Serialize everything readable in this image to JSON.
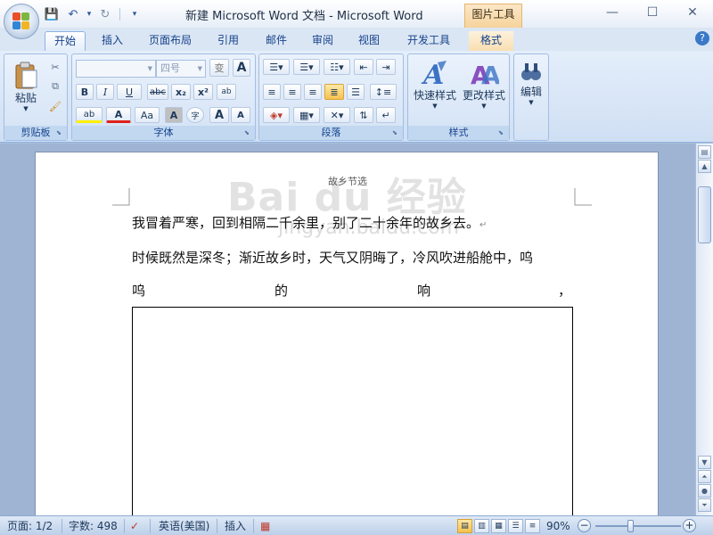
{
  "window": {
    "title": "新建 Microsoft Word 文档 - Microsoft Word",
    "contextual_tab_group": "图片工具",
    "controls": {
      "minimize": "—",
      "maximize": "☐",
      "close": "✕"
    }
  },
  "quick_access": {
    "save": "💾",
    "undo": "↶",
    "redo": "↻",
    "customize": "▾"
  },
  "ribbon_tabs": [
    "开始",
    "插入",
    "页面布局",
    "引用",
    "邮件",
    "审阅",
    "视图",
    "开发工具",
    "格式"
  ],
  "help": "?",
  "groups": {
    "clipboard": {
      "label": "剪贴板",
      "paste": "粘贴",
      "cut": "✂",
      "copy": "⧉",
      "format_painter": "🖌"
    },
    "font": {
      "label": "字体",
      "font_name": "",
      "font_size": "四号",
      "change_case": "变",
      "clear_format": "A",
      "bold": "B",
      "italic": "I",
      "underline": "U",
      "strike": "abc",
      "subscript": "x₂",
      "superscript": "x²",
      "phonetic": "ab",
      "highlight": "ab",
      "font_color": "A",
      "case": "Aa",
      "char_shading": "A",
      "enclose": "字",
      "grow": "A",
      "shrink": "A"
    },
    "paragraph": {
      "label": "段落"
    },
    "styles": {
      "label": "样式",
      "quick_styles": "快速样式",
      "change_styles": "更改样式"
    },
    "editing": {
      "label": "编辑"
    }
  },
  "document": {
    "header_text": "故乡节选",
    "watermark": "Bai du 经验",
    "watermark_url": "jingyan.baidu.com",
    "paragraphs": [
      "我冒着严寒，回到相隔二千余里，别了二十余年的故乡去。",
      "时候既然是深冬；渐近故乡时，天气又阴晦了，冷风吹进船舱中，呜"
    ],
    "justified_line": [
      "呜",
      "的",
      "响",
      "，"
    ],
    "paragraph_mark": "↵"
  },
  "status": {
    "page": "页面: 1/2",
    "words": "字数: 498",
    "language": "英语(美国)",
    "mode": "插入",
    "zoom": "90%",
    "zoom_out": "−",
    "zoom_in": "+"
  }
}
